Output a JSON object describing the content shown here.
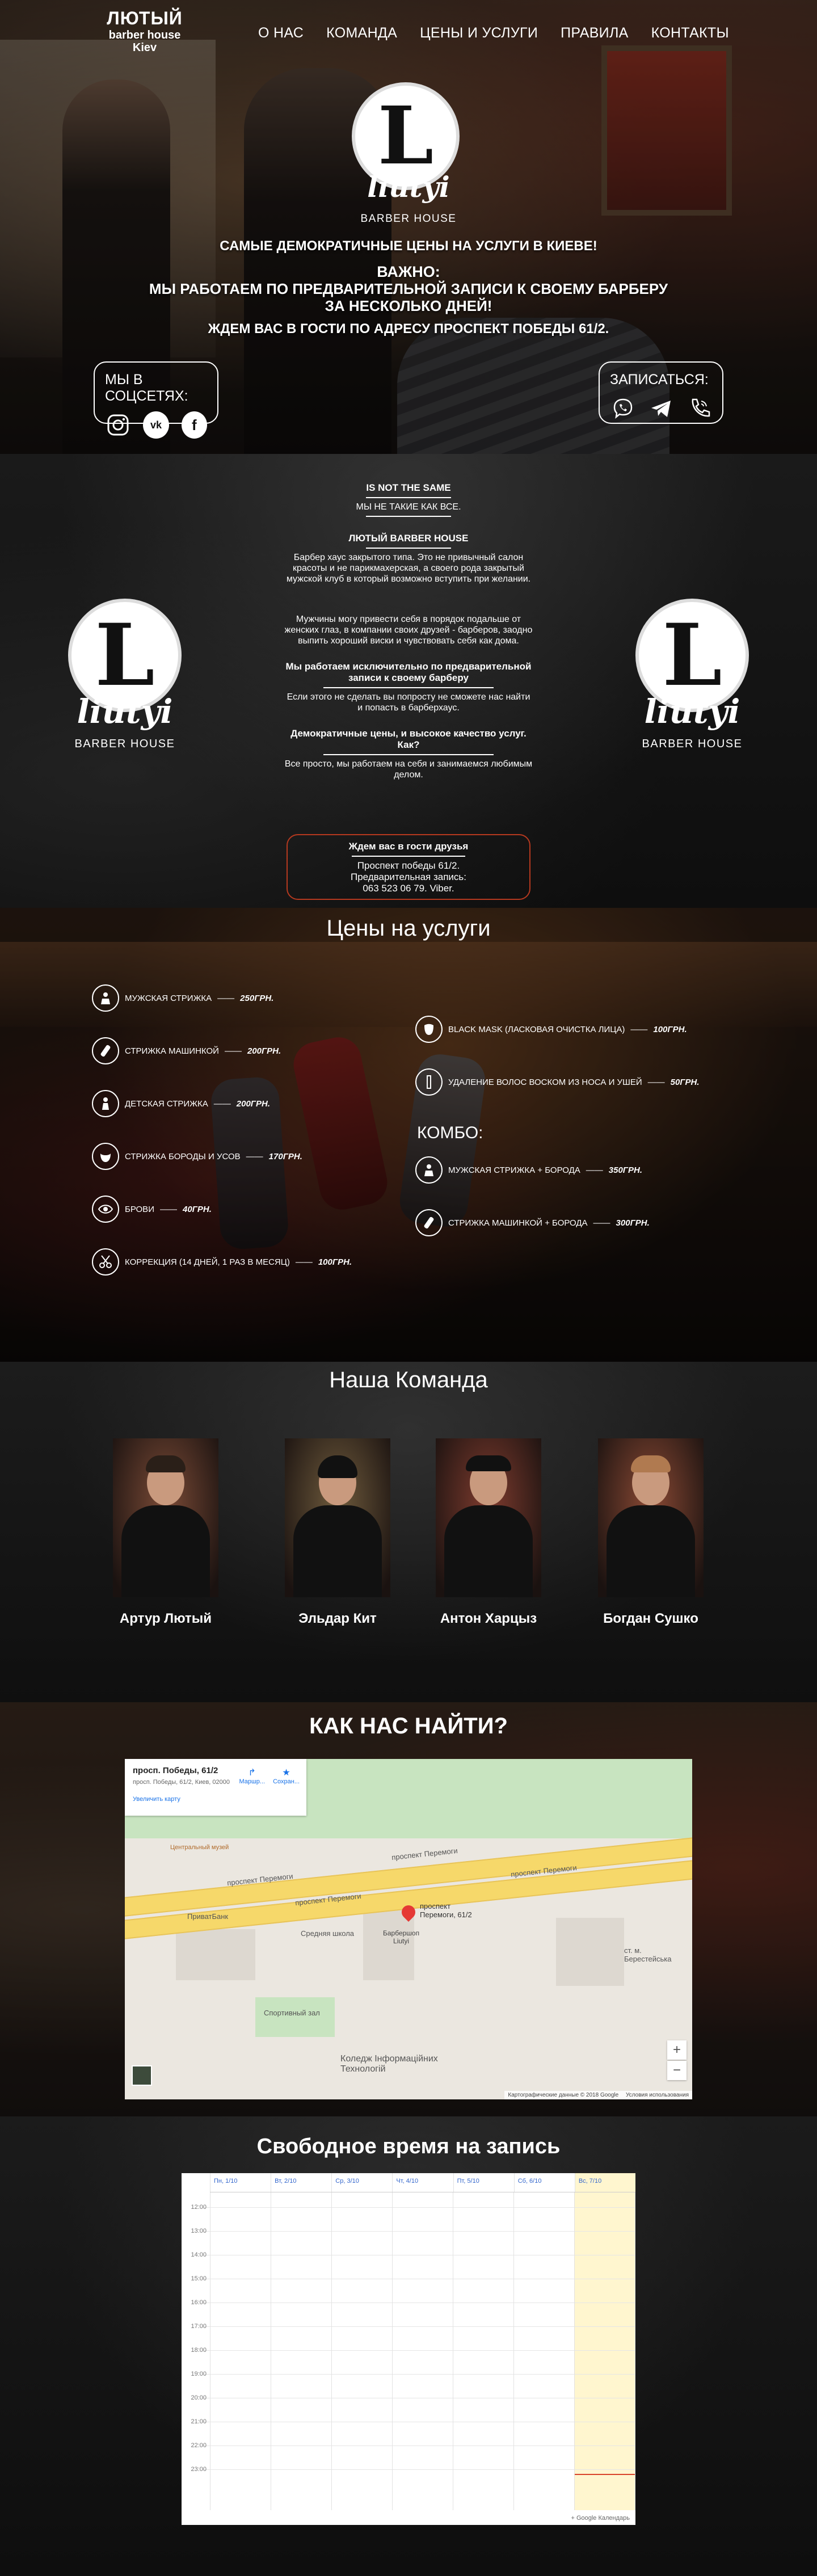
{
  "nav": {
    "brand_name": "ЛЮТЫЙ",
    "brand_sub1": "barber house",
    "brand_sub2": "Kiev",
    "links": [
      "О НАС",
      "КОМАНДА",
      "ЦЕНЫ И УСЛУГИ",
      "ПРАВИЛА",
      "КОНТАКТЫ"
    ]
  },
  "logo": {
    "letter": "L",
    "word": "liutyi",
    "house": "BARBER HOUSE"
  },
  "hero": {
    "line1": "САМЫЕ ДЕМОКРАТИЧНЫЕ ЦЕНЫ НА УСЛУГИ В КИЕВЕ!",
    "line2": "ВАЖНО:",
    "line3": "МЫ РАБОТАЕМ ПО ПРЕДВАРИТЕЛЬНОЙ ЗАПИСИ К СВОЕМУ БАРБЕРУ",
    "line4": "ЗА НЕСКОЛЬКО ДНЕЙ!",
    "line5": "ЖДЕМ ВАС В ГОСТИ ПО АДРЕСУ ПРОСПЕКТ ПОБЕДЫ 61/2.",
    "social_title": "МЫ В СОЦСЕТЯХ:",
    "signup_title": "ЗАПИСАТЬСЯ:",
    "social_icons": [
      "instagram-icon",
      "vk-icon",
      "facebook-icon"
    ],
    "signup_icons": [
      "viber-icon",
      "telegram-icon",
      "phone-icon"
    ]
  },
  "about": {
    "h1": "IS NOT THE SAME",
    "p1": "МЫ НЕ ТАКИЕ КАК ВСЕ.",
    "h2": "ЛЮТЫЙ BARBER HOUSE",
    "p2": "Барбер хаус закрытого типа. Это не привычный салон красоты и не парикмахерская, а своего рода закрытый мужской клуб в который возможно вступить при желании.",
    "p3": "Мужчины могу привести себя в порядок подальше от женских глаз, в компании своих друзей - барберов, заодно выпить хороший виски и чувствовать себя как дома.",
    "h3": "Мы работаем исключительно по предварительной записи к своему барберу",
    "p4": "Если этого не сделать вы попросту не сможете нас найти и попасть в барберхаус.",
    "h4": "Демократичные цены, и высокое качество услуг. Как?",
    "p5": "Все просто, мы работаем на себя и занимаемся любимым делом.",
    "contact_title": "Ждем вас в гости друзья",
    "contact_line1": "Проспект победы 61/2.",
    "contact_line2": "Предварительная запись:",
    "contact_line3": "063 523 06 79. Viber."
  },
  "prices": {
    "title": "Цены на услуги",
    "left": [
      {
        "name": "Мужская стрижка",
        "price": "250ГРН.",
        "icon": "barber-chair-icon"
      },
      {
        "name": "Стрижка машинкой",
        "price": "200ГРН.",
        "icon": "clipper-icon"
      },
      {
        "name": "Детская стрижка",
        "price": "200ГРН.",
        "icon": "child-icon"
      },
      {
        "name": "Стрижка бороды и усов",
        "price": "170ГРН.",
        "icon": "beard-icon"
      },
      {
        "name": "Брови",
        "price": "40ГРН.",
        "icon": "eye-icon"
      },
      {
        "name": "Коррекция (14 дней, 1 раз в месяц)",
        "price": "100ГРН.",
        "icon": "scissors-icon"
      }
    ],
    "right": [
      {
        "name": "Black mask (ласковая очистка лица)",
        "price": "100ГРН.",
        "icon": "mask-icon"
      },
      {
        "name": "Удаление волос воском из носа и ушей",
        "price": "50ГРН.",
        "icon": "razor-icon"
      }
    ],
    "combo_title": "КОМБО:",
    "combo": [
      {
        "name": "Мужская стрижка + борода",
        "price": "350ГРН.",
        "icon": "barber-chair-icon"
      },
      {
        "name": "Стрижка машинкой + борода",
        "price": "300ГРН.",
        "icon": "clipper-icon"
      }
    ]
  },
  "team": {
    "title": "Наша Команда",
    "members": [
      {
        "name": "Артур Лютый",
        "bg": "#7a4a36"
      },
      {
        "name": "Эльдар Кит",
        "bg": "#6e5a3c"
      },
      {
        "name": "Антон Харцыз",
        "bg": "#7e3b2e"
      },
      {
        "name": "Богдан Сушко",
        "bg": "#8a4934"
      }
    ]
  },
  "map": {
    "title": "КАК НАС НАЙТИ?",
    "place_title": "просп. Победы, 61/2",
    "place_addr": "просп. Победы, 61/2, Киев, 02000",
    "enlarge": "Увеличить карту",
    "route": "Маршр...",
    "save": "Сохран...",
    "road1": "проспект Перемоги",
    "road2": "проспект Перемоги",
    "road3": "проспект Перемоги",
    "road4": "проспект Перемоги",
    "pin_label1": "проспект",
    "pin_label2": "Перемоги, 61/2",
    "pin_label3": "Барбершоп",
    "pin_label4": "Liutyi",
    "place_school": "Средняя школа",
    "place_sport": "Спортивный зал",
    "place_college": "Коледж Інформаційних Технологій",
    "place_privatbank": "ПриватБанк",
    "place_metro": "ст. м. Берестейська",
    "place_museum": "Центральный музей",
    "zoom_in": "+",
    "zoom_out": "−",
    "copyright": "Картографические данные © 2018 Google",
    "terms": "Условия использования"
  },
  "schedule": {
    "title": "Свободное время на запись",
    "days": [
      "Пн, 1/10",
      "Вт, 2/10",
      "Ср, 3/10",
      "Чт, 4/10",
      "Пт, 5/10",
      "Сб, 6/10",
      "Вс, 7/10"
    ],
    "times": [
      "12:00",
      "13:00",
      "14:00",
      "15:00",
      "16:00",
      "17:00",
      "18:00",
      "19:00",
      "20:00",
      "21:00",
      "22:00",
      "23:00"
    ],
    "footer": "+ Google Календарь"
  },
  "colors": {
    "accent_border": "#b5391f",
    "calendar_highlight": "#fff6cf"
  }
}
